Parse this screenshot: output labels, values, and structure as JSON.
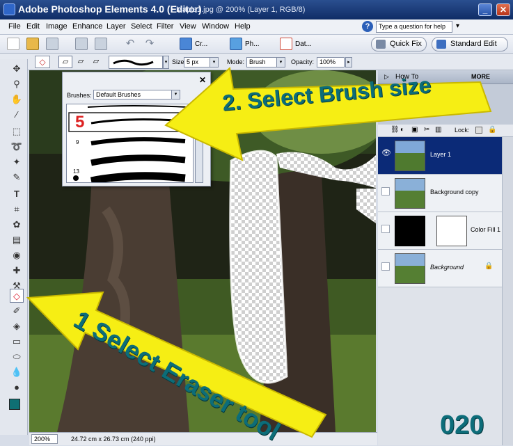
{
  "titlebar": {
    "app_title": "Adobe Photoshop Elements 4.0 (Editor)",
    "doc_title": "Maple1.jpg @ 200% (Layer 1, RGB/8)",
    "min_icon": "minimize-icon",
    "max_icon": "maximize-icon",
    "close_icon": "close-icon"
  },
  "menubar": {
    "items": [
      "File",
      "Edit",
      "Image",
      "Enhance",
      "Layer",
      "Select",
      "Filter",
      "View",
      "Window",
      "Help"
    ],
    "help_placeholder": "Type a question for help"
  },
  "shortcuts": {
    "create_label": "Cr...",
    "photo_label": "Ph...",
    "date_label": "Dat...",
    "quick_fix": "Quick Fix",
    "standard_edit": "Standard Edit"
  },
  "options": {
    "size_label": "Size:",
    "size_value": "5 px",
    "mode_label": "Mode:",
    "mode_value": "Brush",
    "opacity_label": "Opacity:",
    "opacity_value": "100%"
  },
  "brush_popup": {
    "brushes_label": "Brushes:",
    "brushes_value": "Default Brushes",
    "size_samples": [
      "5",
      "9",
      "13"
    ]
  },
  "panels": {
    "how_to_label": "How To",
    "more_label": "MORE",
    "lock_label": "Lock:",
    "layers": [
      {
        "name": "Layer 1",
        "selected": true
      },
      {
        "name": "Background copy",
        "selected": false
      },
      {
        "name": "Color Fill 1",
        "selected": false
      },
      {
        "name": "Background",
        "selected": false
      }
    ]
  },
  "status": {
    "zoom": "200%",
    "dimensions": "24.72 cm x 26.73 cm (240 ppi)"
  },
  "annotations": {
    "step1": "1 Select Eraser tool",
    "step2": "2. Select Brush size",
    "frame_number": "020"
  },
  "colors": {
    "foreground": "#0f6f73",
    "background": "#ffffff",
    "arrow": "#f6ee14",
    "annotation_text": "#0c6d79",
    "selected_layer": "#0b2a77"
  }
}
